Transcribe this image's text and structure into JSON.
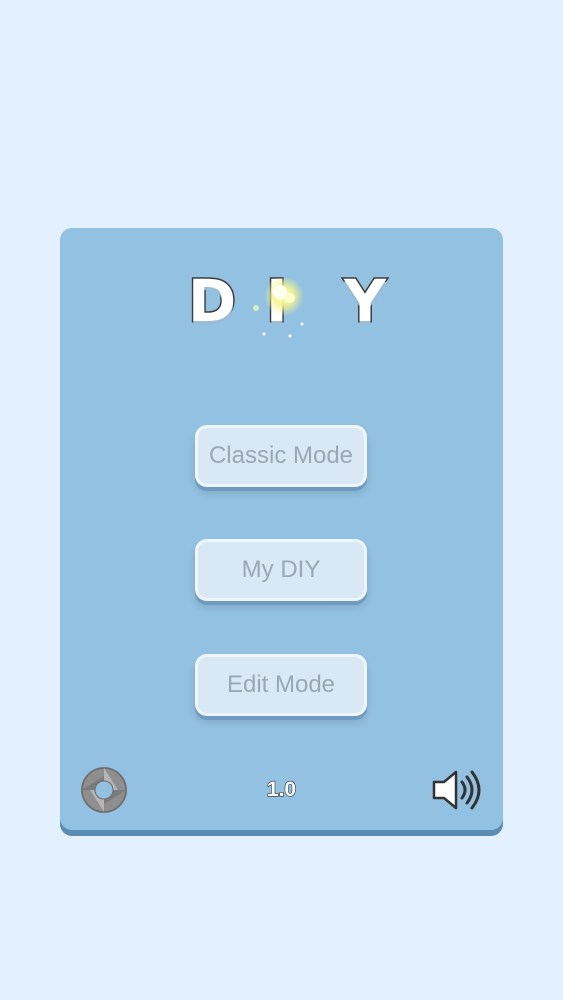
{
  "title": {
    "letters": [
      "D",
      "I",
      "Y"
    ]
  },
  "menu": {
    "classic_label": "Classic Mode",
    "mydiy_label": "My DIY",
    "edit_label": "Edit Mode"
  },
  "footer": {
    "version": "1.0",
    "left_icon": "shutter-icon",
    "right_icon": "speaker-icon"
  },
  "colors": {
    "background": "#e2f1fd",
    "panel": "#93c1e1",
    "panel_shadow": "#5b8cb4",
    "button_face": "#d8e9f5",
    "button_text": "#9aa8b2"
  }
}
